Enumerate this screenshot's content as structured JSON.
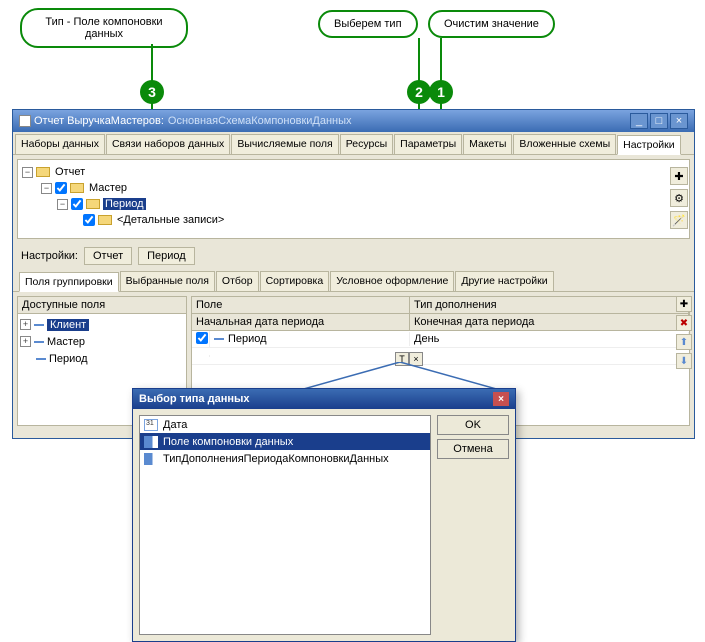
{
  "callouts": {
    "c3": "Тип - Поле компоновки данных",
    "c2": "Выберем тип",
    "c1": "Очистим значение"
  },
  "markers": {
    "m1": "1",
    "m2": "2",
    "m3": "3"
  },
  "window": {
    "title1": "Отчет ВыручкаМастеров:",
    "title2": "ОсновнаяСхемаКомпоновкиДанных",
    "tabs": [
      "Наборы данных",
      "Связи наборов данных",
      "Вычисляемые поля",
      "Ресурсы",
      "Параметры",
      "Макеты",
      "Вложенные схемы",
      "Настройки"
    ],
    "active_tab": 7,
    "tree": {
      "root": "Отчет",
      "n1": "Мастер",
      "n2": "Период",
      "n3": "<Детальные записи>"
    },
    "settings_label": "Настройки:",
    "settings_btns": [
      "Отчет",
      "Период"
    ],
    "subtabs": [
      "Поля группировки",
      "Выбранные поля",
      "Отбор",
      "Сортировка",
      "Условное оформление",
      "Другие настройки"
    ],
    "active_subtab": 0,
    "available_header": "Доступные поля",
    "available": [
      "Клиент",
      "Мастер",
      "Период"
    ],
    "grid": {
      "h1": "Поле",
      "h2": "Тип дополнения",
      "r1c1": "Начальная дата периода",
      "r1c2": "Конечная дата периода",
      "r2c1": "Период",
      "r2c2": "День"
    },
    "type_btn_t": "T",
    "type_btn_x": "×"
  },
  "dialog": {
    "title": "Выбор типа данных",
    "items": [
      "Дата",
      "Поле компоновки данных",
      "ТипДополненияПериодаКомпоновкиДанных"
    ],
    "selected": 1,
    "ok": "OK",
    "cancel": "Отмена"
  }
}
